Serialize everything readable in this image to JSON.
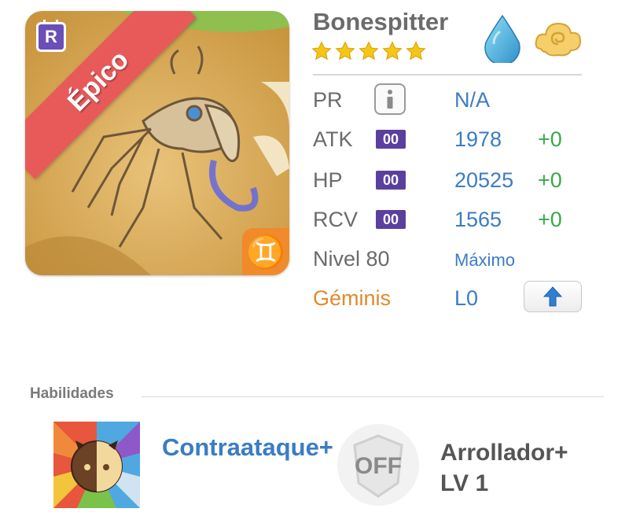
{
  "monster": {
    "name": "Bonespitter",
    "rarity": "Épico",
    "rarity_badge": "R",
    "stars": 5,
    "element": "water-drop-icon",
    "awakening": "cloud-swirl-icon"
  },
  "stats": {
    "pr_label": "PR",
    "pr_value": "N/A",
    "atk_label": "ATK",
    "atk_plus": "00",
    "atk_value": "1978",
    "atk_bonus": "+0",
    "hp_label": "HP",
    "hp_plus": "00",
    "hp_value": "20525",
    "hp_bonus": "+0",
    "rcv_label": "RCV",
    "rcv_plus": "00",
    "rcv_value": "1565",
    "rcv_bonus": "+0",
    "level_label": "Nivel 80",
    "level_status": "Máximo",
    "zodiac": "Géminis",
    "zodiac_symbol": "♊",
    "skill_level": "L0"
  },
  "abilities": {
    "title": "Habilidades",
    "skill_name": "Contraataque+",
    "leader_status": "OFF",
    "leader_name_line1": "Arrollador+",
    "leader_name_line2": "LV 1"
  },
  "colors": {
    "blue_text": "#3b7cc4",
    "green_bonus": "#3aa84a",
    "orange_zodiac": "#e08a2e",
    "rarity_red": "#e85a5a",
    "badge_purple": "#5b3f9e",
    "star_yellow": "#f5c518"
  }
}
